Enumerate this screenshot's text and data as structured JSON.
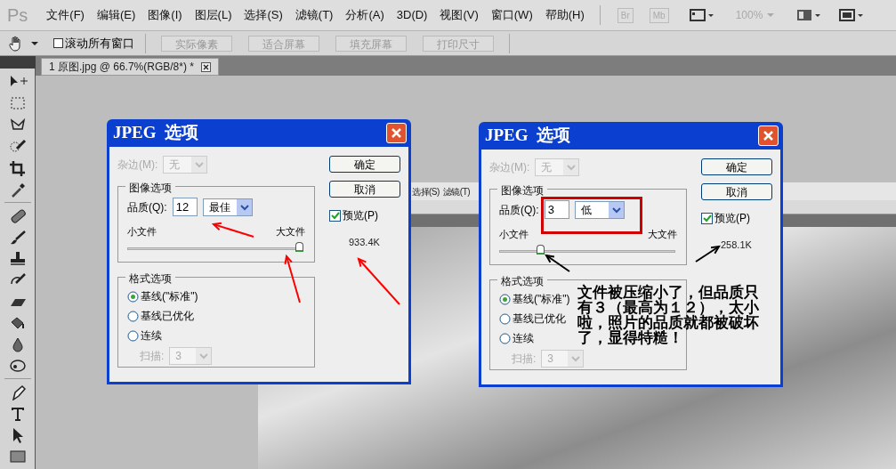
{
  "app": {
    "logo": "Ps",
    "menu": [
      "文件(F)",
      "编辑(E)",
      "图像(I)",
      "图层(L)",
      "选择(S)",
      "滤镜(T)",
      "分析(A)",
      "3D(D)",
      "视图(V)",
      "窗口(W)",
      "帮助(H)"
    ],
    "bridge_buttons": [
      "Br",
      "Mb"
    ],
    "zoom": "100%"
  },
  "options_bar": {
    "scroll_all": {
      "label": "滚动所有窗口",
      "checked": false
    },
    "buttons": [
      "实际像素",
      "适合屏幕",
      "填充屏幕",
      "打印尺寸"
    ]
  },
  "document_tab": {
    "title": "1 原图.jpg @ 66.7%(RGB/8*) *"
  },
  "background_screenshot": {
    "menu": [
      "选择(S)",
      "滤镜(T)"
    ]
  },
  "dialogs": [
    {
      "title": "JPEG  选项",
      "matte": {
        "label": "杂边(M):",
        "value": "无",
        "disabled": true
      },
      "image_options": "图像选项",
      "quality_label": "品质(Q):",
      "quality_value": "12",
      "quality_preset": "最佳",
      "small_label": "小文件",
      "large_label": "大文件",
      "level": 1,
      "format_title": "格式选项",
      "formats": [
        {
          "label": "基线(\"标准\")",
          "selected": true
        },
        {
          "label": "基线已优化",
          "selected": false
        },
        {
          "label": "连续",
          "selected": false
        }
      ],
      "scan": {
        "label": "扫描:",
        "value": "3",
        "disabled": true
      },
      "ok": "确定",
      "cancel": "取消",
      "preview": {
        "label": "预览(P)",
        "checked": true
      },
      "size": "933.4K",
      "color": "#ff0000",
      "highlight": false
    },
    {
      "title": "JPEG  选项",
      "matte": {
        "label": "杂边(M):",
        "value": "无",
        "disabled": true
      },
      "image_options": "图像选项",
      "quality_label": "品质(Q):",
      "quality_value": "3",
      "quality_preset": "低",
      "small_label": "小文件",
      "large_label": "大文件",
      "level": 0.22,
      "format_title": "格式选项",
      "formats": [
        {
          "label": "基线(\"标准\")",
          "selected": true
        },
        {
          "label": "基线已优化",
          "selected": false
        },
        {
          "label": "连续",
          "selected": false
        }
      ],
      "scan": {
        "label": "扫描:",
        "value": "3",
        "disabled": true
      },
      "ok": "确定",
      "cancel": "取消",
      "preview": {
        "label": "预览(P)",
        "checked": true
      },
      "size": "258.1K",
      "color": "#000000",
      "highlight": true,
      "note": "文件被压缩小了，但品质只有３（最高为１２），太小啦，照片的品质就都被破坏了，显得特糙！"
    }
  ]
}
